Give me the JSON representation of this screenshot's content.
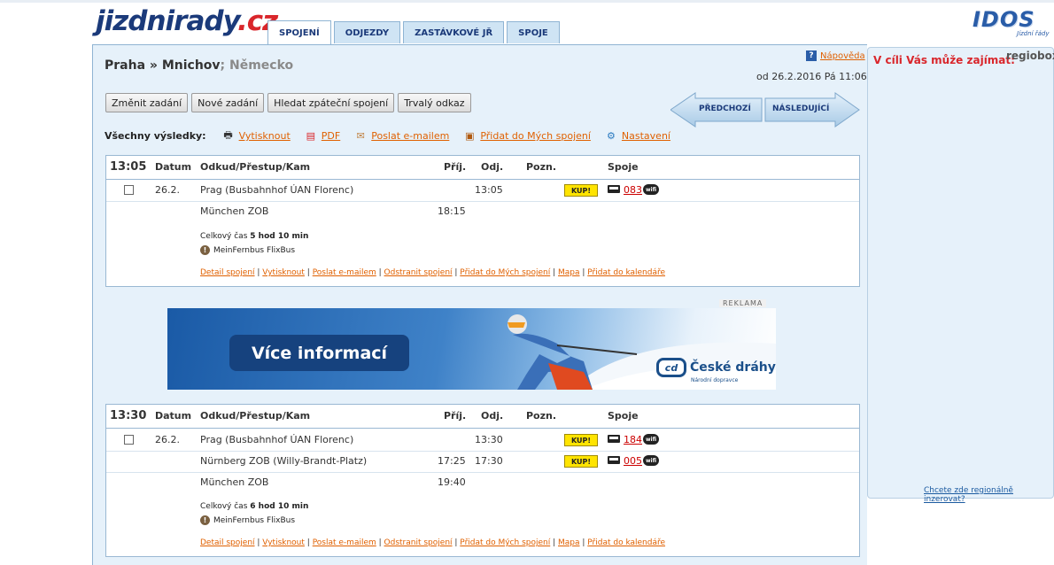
{
  "header": {
    "logo_main": "jizdnirady",
    "logo_tld": ".cz",
    "idos_logo": "IDOS",
    "idos_sub": "Jízdní řády",
    "tabs": [
      {
        "label": "SPOJENÍ",
        "active": true
      },
      {
        "label": "ODJEZDY",
        "active": false
      },
      {
        "label": "ZASTÁVKOVÉ JŘ",
        "active": false
      },
      {
        "label": "SPOJE",
        "active": false
      }
    ]
  },
  "search": {
    "route_main": "Praha » Mnichov",
    "route_country": "; Německo",
    "help_label": "Nápověda",
    "datetime": "od 26.2.2016 Pá 11:06",
    "buttons": [
      "Změnit zadání",
      "Nové zadání",
      "Hledat zpáteční spojení",
      "Trvalý odkaz"
    ],
    "prev_label": "PŘEDCHOZÍ",
    "next_label": "NÁSLEDUJÍCÍ"
  },
  "all_results": {
    "label": "Všechny výsledky:",
    "actions": [
      {
        "label": "Vytisknout",
        "icon": "printer-icon"
      },
      {
        "label": "PDF",
        "icon": "pdf-icon"
      },
      {
        "label": "Poslat e-mailem",
        "icon": "envelope-icon"
      },
      {
        "label": "Přidat do Mých spojení",
        "icon": "briefcase-icon"
      },
      {
        "label": "Nastavení",
        "icon": "gear-icon"
      }
    ]
  },
  "columns": {
    "datum": "Datum",
    "stops": "Odkud/Přestup/Kam",
    "arr": "Příj.",
    "dep": "Odj.",
    "note": "Pozn.",
    "conn": "Spoje"
  },
  "connections": [
    {
      "time": "13:05",
      "rows": [
        {
          "date": "26.2.",
          "stop": "Prag (Busbahnhof ÚAN Florenc)",
          "arr": "",
          "dep": "13:05",
          "kup": "KUP!",
          "line": "083"
        },
        {
          "date": "",
          "stop": "München ZOB",
          "arr": "18:15",
          "dep": "",
          "kup": "",
          "line": ""
        }
      ],
      "total_label": "Celkový čas",
      "total_value": "5 hod 10 min",
      "carrier": "MeinFernbus FlixBus"
    },
    {
      "time": "13:30",
      "rows": [
        {
          "date": "26.2.",
          "stop": "Prag (Busbahnhof ÚAN Florenc)",
          "arr": "",
          "dep": "13:30",
          "kup": "KUP!",
          "line": "184"
        },
        {
          "date": "",
          "stop": "Nürnberg ZOB (Willy-Brandt-Platz)",
          "arr": "17:25",
          "dep": "17:30",
          "kup": "KUP!",
          "line": "005"
        },
        {
          "date": "",
          "stop": "München ZOB",
          "arr": "19:40",
          "dep": "",
          "kup": "",
          "line": ""
        }
      ],
      "total_label": "Celkový čas",
      "total_value": "6 hod 10 min",
      "carrier": "MeinFernbus FlixBus"
    }
  ],
  "conn_links": [
    "Detail spojení",
    "Vytisknout",
    "Poslat e-mailem",
    "Odstranit spojení",
    "Přidat do Mých spojení",
    "Mapa",
    "Přidat do kalendáře"
  ],
  "ad": {
    "label": "REKLAMA",
    "button": "Více informací",
    "brand": "České dráhy",
    "brand_sub": "Národní dopravce",
    "logo_text": "cd"
  },
  "sidebar": {
    "title": "V cíli Vás může zajímat:",
    "partner": "regiobox",
    "link": "Chcete zde regionálně inzerovat?"
  }
}
